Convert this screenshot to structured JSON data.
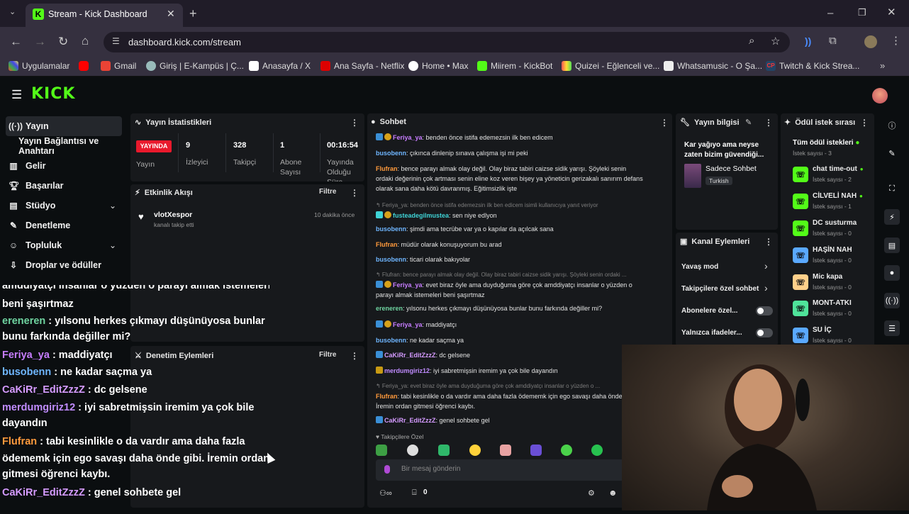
{
  "browser": {
    "tab_title": "Stream - Kick Dashboard",
    "url": "dashboard.kick.com/stream",
    "bookmarks": [
      "Uygulamalar",
      "Gmail",
      "Giriş | E-Kampüs | Ç...",
      "Anasayfa / X",
      "Ana Sayfa - Netflix",
      "Home • Max",
      "Miirem - KickBot",
      "Quizei - Eğlenceli ve...",
      "Whatsamusic - O Şa...",
      "Twitch & Kick Strea..."
    ]
  },
  "kick": {
    "logo": "KICK"
  },
  "sidebar": {
    "items": [
      "Yayın",
      "Yayın Bağlantısı ve Anahtarı",
      "Gelir",
      "Başarılar",
      "Stüdyo",
      "Denetleme",
      "Topluluk",
      "Droplar ve ödüller"
    ]
  },
  "stats": {
    "title": "Yayın İstatistikleri",
    "live_badge": "YAYINDA",
    "status_label": "Yayın",
    "items": [
      {
        "value": "9",
        "label": "İzleyici"
      },
      {
        "value": "328",
        "label": "Takipçi"
      },
      {
        "value": "1",
        "label": "Abone Sayısı"
      },
      {
        "value": "00:16:54",
        "label": "Yayında Olduğu Süre"
      }
    ]
  },
  "activity": {
    "title": "Etkinlik Akışı",
    "filter": "Filtre",
    "event_user": "vlotXespor",
    "event_text": "kanalı takip etti",
    "event_time": "10 dakika önce"
  },
  "moderation": {
    "title": "Denetim Eylemleri",
    "filter": "Filtre"
  },
  "overlay_chat": [
    {
      "user": "",
      "text": "amddiyatçı insanlar o yüzden o parayı almak istemeleri",
      "color": "#ffffff"
    },
    {
      "user": "",
      "text": "beni şaşırtmaz",
      "color": "#ffffff"
    },
    {
      "user": "ereneren",
      "text": " : yılsonu herkes çıkmayı düşünüyosa bunlar",
      "color": "#6fd3a0"
    },
    {
      "user": "",
      "text": "bunu farkında değiller mi?",
      "color": "#ffffff"
    },
    {
      "user": "Feriya_ya",
      "text": " : maddiyatçı",
      "color": "#c77dff"
    },
    {
      "user": "busobenn",
      "text": " : ne kadar saçma ya",
      "color": "#6fb6ff"
    },
    {
      "user": "CaKiRr_EditZzzZ",
      "text": " : dc gelsene",
      "color": "#d59bff"
    },
    {
      "user": "merdumgiriz12",
      "text": " : iyi sabretmişsin iremim ya çok bile",
      "color": "#c08cff"
    },
    {
      "user": "",
      "text": "dayandın",
      "color": "#ffffff"
    },
    {
      "user": "Flufran",
      "text": " : tabi kesinlikle o da vardır ama daha fazla",
      "color": "#ff9a3c"
    },
    {
      "user": "",
      "text": "ödememk için ego savaşı daha önde gibi. İremin ordan",
      "color": "#ffffff"
    },
    {
      "user": "",
      "text": "gitmesi öğrenci kaybı.",
      "color": "#ffffff"
    },
    {
      "user": "CaKiRr_EditZzzZ",
      "text": " : genel sohbete gel",
      "color": "#d59bff"
    }
  ],
  "chat": {
    "title": "Sohbet",
    "lines": [
      {
        "sys": "",
        "user": "Feriya_ya",
        "color": "#c77dff",
        "text": ": benden önce istifa edemezsin ilk ben edicem"
      },
      {
        "sys": "",
        "user": "busobenn",
        "color": "#6fb6ff",
        "text": ": çıkınca dinlenip sınava çalışma işi mi peki"
      },
      {
        "sys": "",
        "user": "Flufran",
        "color": "#ff9a3c",
        "text": ": bence parayı almak olay değil. Olay biraz tabiri caizse sidik yarışı. Şöyleki senin ordaki değerinin çok artması senin eline koz veren bişey ya yöneticin gerizakalı sanırım defans olarak sana daha kötü davranmış. Eğitimsizlik işte"
      },
      {
        "sys": "↰ Feriya_ya: benden önce istifa edemezsin ilk ben edicem isimli kullanıcıya yanıt veriyor",
        "user": "fusteadegilmustea",
        "color": "#3fd3d6",
        "text": ": sen niye edlyon"
      },
      {
        "sys": "",
        "user": "busobenn",
        "color": "#6fb6ff",
        "text": ": şimdi ama tecrübe var ya o kapılar da açılcak sana"
      },
      {
        "sys": "",
        "user": "Flufran",
        "color": "#ff9a3c",
        "text": ": müdür olarak konuşuyorum bu arad"
      },
      {
        "sys": "",
        "user": "busobenn",
        "color": "#6fb6ff",
        "text": ": ticari olarak bakıyolar"
      },
      {
        "sys": "↰ Flufran: bence parayı almak olay değil. Olay biraz tabiri caizse sidik yarışı. Şöyleki senin ordaki ...",
        "user": "Feriya_ya",
        "color": "#c77dff",
        "text": ": evet biraz öyle ama duyduğuma göre çok amddiyatçı insanlar o yüzden o parayı almak istemeleri beni şaşırtmaz"
      },
      {
        "sys": "",
        "user": "ereneren",
        "color": "#6fd3a0",
        "text": ": yılsonu herkes çıkmayı düşünüyosa bunlar bunu farkında değiller mi?"
      },
      {
        "sys": "",
        "user": "Feriya_ya",
        "color": "#c77dff",
        "text": ": maddiyatçı"
      },
      {
        "sys": "",
        "user": "busobenn",
        "color": "#6fb6ff",
        "text": ": ne kadar saçma ya"
      },
      {
        "sys": "",
        "user": "CaKiRr_EditZzzZ",
        "color": "#d59bff",
        "text": ": dc gelsene"
      },
      {
        "sys": "",
        "user": "merdumgiriz12",
        "color": "#c08cff",
        "text": ": iyi sabretmişsin iremim ya çok bile dayandın"
      },
      {
        "sys": "↰ Feriya_ya: evet biraz öyle ama duyduğuma göre çok amddiyatçı insanlar o yüzden o ...",
        "user": "Flufran",
        "color": "#ff9a3c",
        "text": ": tabi kesinlikle o da vardır ama daha fazla ödememk için ego savaşı daha önde gibi. İremin ordan gitmesi öğrenci kaybı."
      },
      {
        "sys": "",
        "user": "CaKiRr_EditZzzZ",
        "color": "#d59bff",
        "text": ": genel sohbete gel"
      }
    ],
    "followers_only": "Takipçilere Özel",
    "input_placeholder": "Bir mesaj gönderin",
    "count": "0"
  },
  "stream_info": {
    "title": "Yayın bilgisi",
    "stream_title": "Kar yağıyo ama neyse zaten bizim güvendiği...",
    "category": "Sadece Sohbet",
    "tag": "Turkish"
  },
  "channel_actions": {
    "title": "Kanal Eylemleri",
    "items": [
      "Yavaş mod",
      "Takipçilere özel sohbet",
      "Abonelere özel...",
      "Yalnızca ifadeler..."
    ]
  },
  "rewards": {
    "title": "Ödül istek sırası",
    "all": "Tüm ödül istekleri",
    "all_count": "İstek sayısı - 3",
    "items": [
      {
        "name": "chat time-out",
        "count": "İstek sayısı - 2",
        "color": "#53fc18",
        "dot": true
      },
      {
        "name": "CİLVELİ NAH",
        "count": "İstek sayısı - 1",
        "color": "#53fc18",
        "dot": true
      },
      {
        "name": "DC susturma",
        "count": "İstek sayısı - 0",
        "color": "#53fc18",
        "dot": false
      },
      {
        "name": "HAŞİN NAH",
        "count": "İstek sayısı - 0",
        "color": "#5aa9ff",
        "dot": false
      },
      {
        "name": "Mic kapa",
        "count": "İstek sayısı - 0",
        "color": "#ffd08a",
        "dot": false
      },
      {
        "name": "MONT-ATKI",
        "count": "İstek sayısı - 0",
        "color": "#4fe39a",
        "dot": false
      },
      {
        "name": "SU İÇ",
        "count": "İstek sayısı - 0",
        "color": "#5aa9ff",
        "dot": false
      }
    ]
  },
  "colors": {
    "brand": "#53fc18",
    "live": "#e9192c",
    "panel": "#17191c"
  }
}
